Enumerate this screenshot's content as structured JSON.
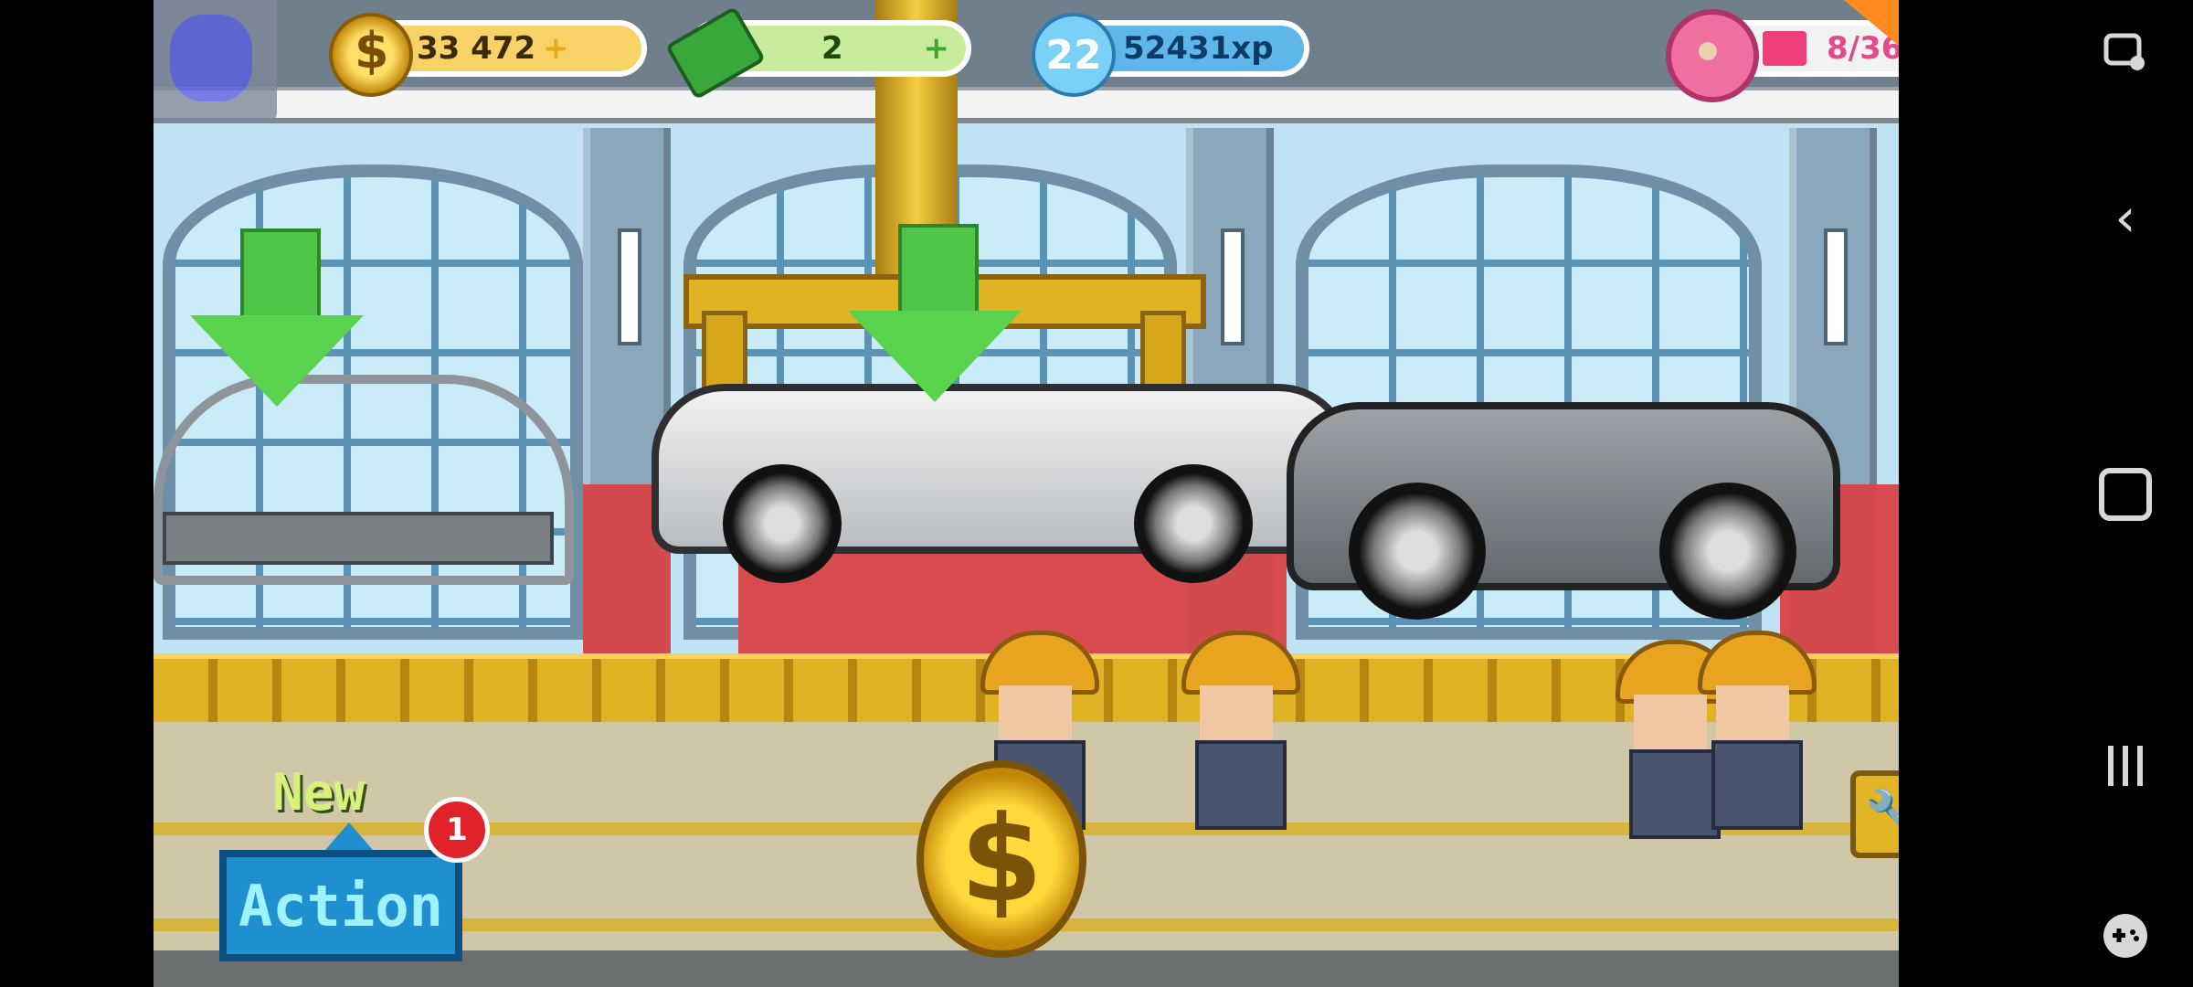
{
  "hud": {
    "coins": "33 472",
    "coins_plus": "+",
    "cash": "2",
    "cash_plus": "+",
    "level": "22",
    "xp": "52431xp",
    "donuts": "8/36",
    "donut_progress": 0.22
  },
  "buttons": {
    "new_label": "New",
    "action_label": "Action",
    "notification_count": "1",
    "coin_symbol": "$",
    "wrench_symbol": "🔧"
  },
  "icons": {
    "pause": "pause-icon",
    "coin": "coin-icon",
    "cash": "cash-icon",
    "level": "level-badge-icon",
    "donut": "donut-icon",
    "wrench": "wrench-icon"
  },
  "colors": {
    "accent_green": "#59d24e",
    "action_blue": "#1f8fd0",
    "coin_gold": "#ffd93c",
    "donut_pink": "#ef3f7c"
  },
  "nav": {
    "back": "‹"
  }
}
